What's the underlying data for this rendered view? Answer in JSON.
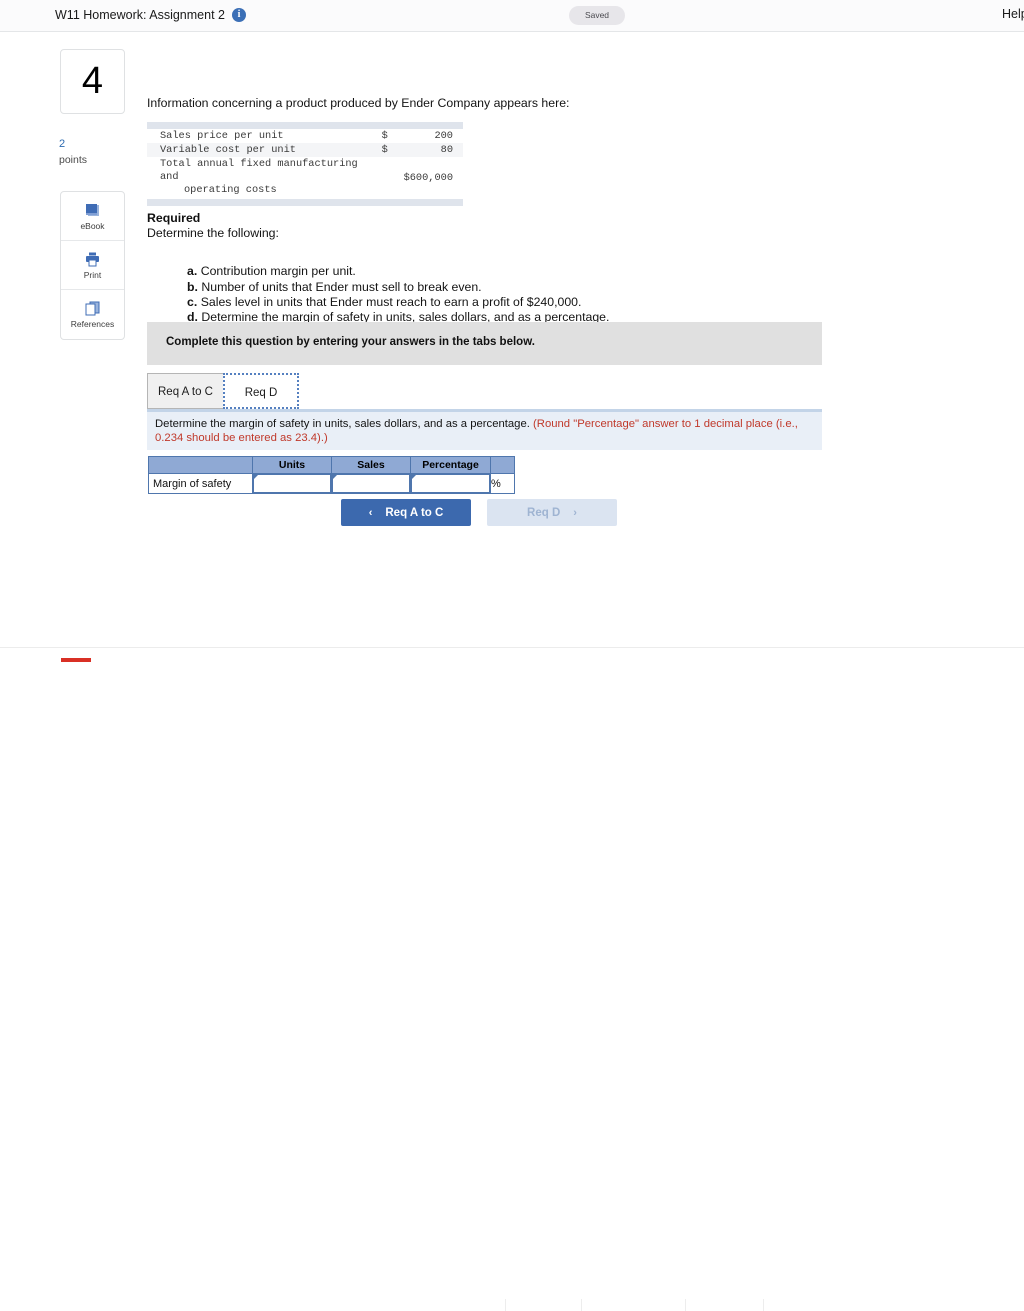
{
  "topbar": {
    "assignment_title": "W11 Homework: Assignment 2",
    "info_icon": "i",
    "saved_badge": "Saved",
    "help_link": "Help"
  },
  "left_rail": {
    "question_number": "4",
    "points_value": "2",
    "points_label": "points",
    "tools": [
      {
        "label": "eBook",
        "icon": "ebook-icon"
      },
      {
        "label": "Print",
        "icon": "printer-icon"
      },
      {
        "label": "References",
        "icon": "references-icon"
      }
    ]
  },
  "question": {
    "intro": "Information concerning a product produced by Ender Company appears here:",
    "fin_table": {
      "rows": [
        {
          "label": "Sales price per unit",
          "currency": "$",
          "value": "200"
        },
        {
          "label": "Variable cost per unit",
          "currency": "$",
          "value": "80"
        },
        {
          "label_line1": "Total annual fixed manufacturing and",
          "label_line2": "operating costs",
          "currency": "",
          "value": "$600,000"
        }
      ]
    },
    "required_heading": "Required",
    "required_sub": "Determine the following:",
    "requirements": [
      {
        "letter": "a.",
        "text": "Contribution margin per unit."
      },
      {
        "letter": "b.",
        "text": "Number of units that Ender must sell to break even."
      },
      {
        "letter": "c.",
        "text": "Sales level in units that Ender must reach to earn a profit of $240,000."
      },
      {
        "letter": "d.",
        "text": "Determine the margin of safety in units, sales dollars, and as a percentage."
      }
    ]
  },
  "answer_area": {
    "complete_banner": "Complete this question by entering your answers in the tabs below.",
    "tabs": [
      {
        "id": "req-a-to-c",
        "label": "Req A to C",
        "active": false
      },
      {
        "id": "req-d",
        "label": "Req D",
        "active": true
      }
    ],
    "instruction": {
      "main": "Determine the margin of safety in units, sales dollars, and as a percentage.",
      "note": "(Round \"Percentage\" answer to 1 decimal place (i.e., 0.234 should be entered as 23.4).)"
    },
    "grid": {
      "corner_header": "",
      "headers": [
        "Units",
        "Sales",
        "Percentage"
      ],
      "rows": [
        {
          "label": "Margin of safety",
          "units_value": "",
          "sales_value": "",
          "percentage_value": "",
          "percent_sign": "%"
        }
      ]
    },
    "nav": {
      "prev_label": "Req A to C",
      "prev_chevron": "‹",
      "next_label": "Req D",
      "next_chevron": "›"
    }
  },
  "colors": {
    "accent_blue": "#3c69ae",
    "grid_header_blue": "#8fa9d4",
    "grid_border_blue": "#4f76ad",
    "note_red": "#c0392b",
    "banner_gray": "#e0e0e0",
    "instruction_blue": "#e9eff7",
    "bottom_red": "#d93025"
  }
}
